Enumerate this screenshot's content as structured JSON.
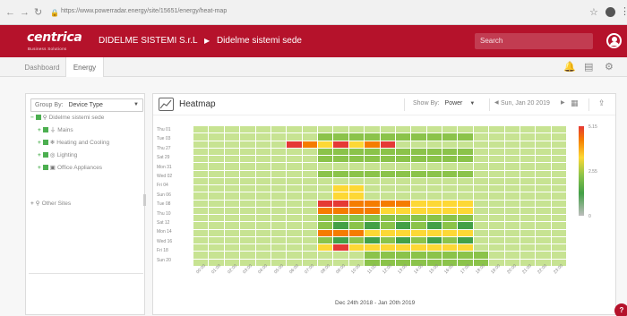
{
  "browser": {
    "url": "https://www.powerradar.energy/site/15651/energy/heat-map"
  },
  "app": {
    "brand": "centrica",
    "brand_sub": "Business Solutions",
    "breadcrumb_company": "DIDELME SISTEMI S.r.L",
    "breadcrumb_site": "Didelme sistemi sede",
    "search_placeholder": "Search"
  },
  "tabs": [
    {
      "label": "Dashboard"
    },
    {
      "label": "Energy"
    }
  ],
  "left_panel": {
    "group_by_label": "Group By:",
    "group_by_value": "Device Type",
    "tree": [
      {
        "label": "Didelme sistemi sede",
        "icon": "pin-icon"
      },
      {
        "label": "Mains",
        "icon": "plug-icon"
      },
      {
        "label": "Heating and Cooling",
        "icon": "snowflake-icon"
      },
      {
        "label": "Lighting",
        "icon": "bulb-icon"
      },
      {
        "label": "Office Appliances",
        "icon": "printer-icon"
      }
    ],
    "other_sites": "Other Sites"
  },
  "heatmap": {
    "title": "Heatmap",
    "show_by_label": "Show By:",
    "show_by_value": "Power",
    "date_display": "Sun, Jan 20 2019",
    "days": [
      "Thu 01",
      "Tue 03",
      "Thu 27",
      "Sat 29",
      "Mon 31",
      "Wed 02",
      "Fri 04",
      "Sun 06",
      "Tue 08",
      "Thu 10",
      "Sat 12",
      "Mon 14",
      "Wed 16",
      "Fri 18",
      "Sun 20"
    ],
    "hours": [
      "00:00",
      "01:00",
      "02:00",
      "03:00",
      "04:00",
      "05:00",
      "06:00",
      "07:00",
      "08:00",
      "09:00",
      "10:00",
      "11:00",
      "12:00",
      "13:00",
      "14:00",
      "15:00",
      "16:00",
      "17:00",
      "18:00",
      "19:00",
      "20:00",
      "21:00",
      "22:00",
      "23:00"
    ],
    "date_range": "Dec 24th 2018 - Jan 20th 2019",
    "legend_labels": [
      "5.15",
      "2.55",
      "0"
    ],
    "colors": {
      "red": "#e53935",
      "orange": "#f57c00",
      "yellow": "#fdd835",
      "light_green": "#c7e392",
      "green": "#8bc34a",
      "dark_green": "#43a047",
      "grey": "#e0e0e0"
    }
  }
}
